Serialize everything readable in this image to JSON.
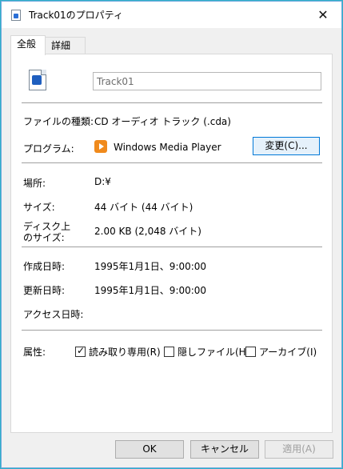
{
  "window": {
    "title": "Track01のプロパティ"
  },
  "tabs": [
    {
      "label": "全般"
    },
    {
      "label": "詳細"
    }
  ],
  "general": {
    "file_name": "Track01",
    "file_type_label": "ファイルの種類:",
    "file_type_value": "CD オーディオ トラック (.cda)",
    "program_label": "プログラム:",
    "program_value": "Windows Media Player",
    "change_button": "変更(C)...",
    "location_label": "場所:",
    "location_value": "D:¥",
    "size_label": "サイズ:",
    "size_value": "44 バイト (44 バイト)",
    "disk_size_label_line1": "ディスク上",
    "disk_size_label_line2": "のサイズ:",
    "disk_size_value": "2.00 KB (2,048 バイト)",
    "created_label": "作成日時:",
    "created_value": "1995年1月1日、9:00:00",
    "modified_label": "更新日時:",
    "modified_value": "1995年1月1日、9:00:00",
    "accessed_label": "アクセス日時:",
    "attributes_label": "属性:",
    "attributes": [
      {
        "label": "読み取り専用(R)",
        "checked": true
      },
      {
        "label": "隠しファイル(H)",
        "checked": false
      },
      {
        "label": "アーカイブ(I)",
        "checked": false
      }
    ]
  },
  "footer": {
    "ok": "OK",
    "cancel": "キャンセル",
    "apply": "適用(A)"
  },
  "icons": {
    "title": "cda-file-icon",
    "file": "cda-file-icon",
    "program": "windows-media-player-icon",
    "close": "close-icon"
  }
}
